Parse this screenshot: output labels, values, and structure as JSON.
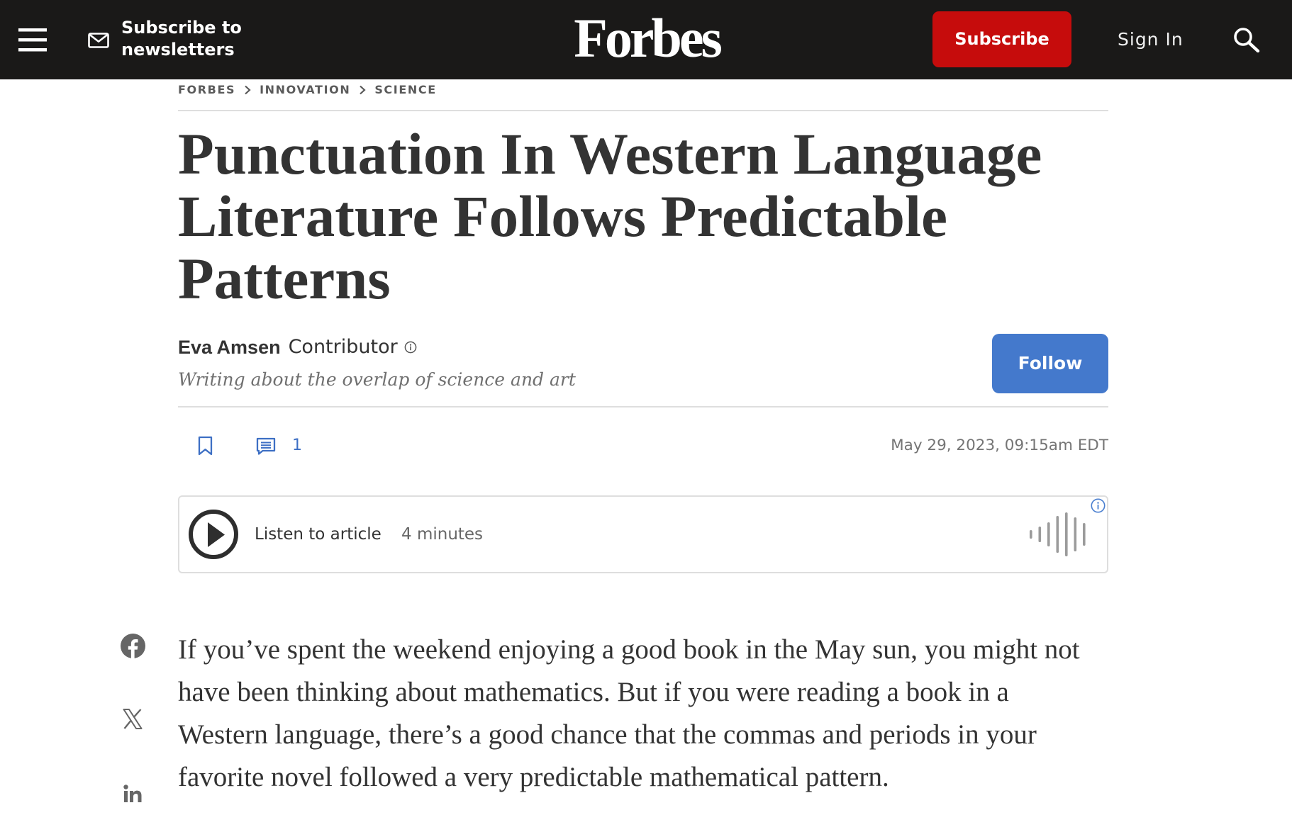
{
  "header": {
    "newsletter_label": "Subscribe to newsletters",
    "logo": "Forbes",
    "subscribe_label": "Subscribe",
    "sign_in_label": "Sign In"
  },
  "breadcrumb": [
    {
      "label": "FORBES"
    },
    {
      "label": "INNOVATION"
    },
    {
      "label": "SCIENCE"
    }
  ],
  "article": {
    "title": "Punctuation In Western Language Literature Follows Predictable Patterns",
    "author": {
      "name": "Eva Amsen",
      "role": "Contributor",
      "tagline": "Writing about the overlap of science and art"
    },
    "follow_label": "Follow",
    "comment_count": "1",
    "published": "May 29, 2023, 09:15am EDT",
    "listen": {
      "label": "Listen to article",
      "duration": "4 minutes"
    },
    "body": [
      "If you’ve spent the weekend enjoying a good book in the May sun, you might not have been thinking about mathematics. But if you were reading a book in a Western language, there’s a good chance that the commas and periods in your favorite novel followed a very predictable mathematical pattern."
    ]
  },
  "colors": {
    "header_background": "#1a1918",
    "subscribe_button": "#c60c0c",
    "follow_button": "#4479cc",
    "accent_blue": "#3d6fc4",
    "text_primary": "#333333",
    "text_muted": "#757575",
    "social_icon": "#666666"
  },
  "icons": {
    "menu": "menu-icon",
    "newsletter": "mail-icon",
    "search": "search-icon",
    "breadcrumb_separator": "chevron-right-icon",
    "author_info": "info-icon",
    "bookmark": "bookmark-icon",
    "comments": "comment-icon",
    "play": "play-icon",
    "audio": "audio-waveform-icon",
    "audio_info": "info-icon",
    "share": [
      "facebook-icon",
      "x-icon",
      "linkedin-icon"
    ]
  }
}
